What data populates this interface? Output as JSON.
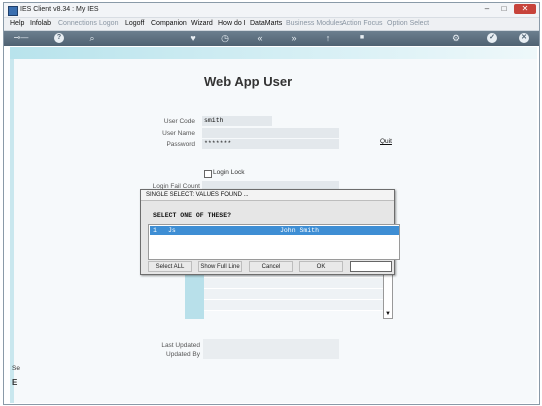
{
  "window": {
    "title": "IES Client v8.34 : My IES"
  },
  "menu": [
    {
      "label": "Help",
      "enabled": true
    },
    {
      "label": "Infolab",
      "enabled": true
    },
    {
      "label": "Connections",
      "enabled": false
    },
    {
      "label": "Logon",
      "enabled": false
    },
    {
      "label": "Logoff",
      "enabled": true
    },
    {
      "label": "Companion",
      "enabled": true
    },
    {
      "label": "Wizard",
      "enabled": true
    },
    {
      "label": "How do I",
      "enabled": true
    },
    {
      "label": "DataMarts",
      "enabled": true
    },
    {
      "label": "Business Modules",
      "enabled": false
    },
    {
      "label": "Action Focus",
      "enabled": false
    },
    {
      "label": "Option Select",
      "enabled": false
    }
  ],
  "toolbar_icons": [
    "key-icon",
    "help-icon",
    "search-icon",
    "heart-icon",
    "clock-icon",
    "rewind-icon",
    "forward-icon",
    "up-icon",
    "stop-icon",
    "gear-icon",
    "check-icon",
    "close-icon"
  ],
  "page": {
    "title": "Web App User",
    "user_code_label": "User Code",
    "user_code_value": "smith",
    "user_name_label": "User Name",
    "user_name_value": "",
    "password_label": "Password",
    "password_value": "*******",
    "quit_label": "Quit",
    "login_lock_label": "Login Lock",
    "login_fail_label": "Login Fail Count",
    "last_updated_label": "Last Updated",
    "updated_by_label": "Updated By",
    "left_cut_1": "Se",
    "left_cut_2": "E"
  },
  "dialog": {
    "title": "SINGLE SELECT: VALUES FOUND ...",
    "prompt": "SELECT ONE OF THESE?",
    "rows": [
      {
        "num": "1",
        "code": "Js",
        "name": "John Smith"
      }
    ],
    "buttons": {
      "select_all": "Select ALL",
      "show_full_line": "Show Full Line",
      "cancel": "Cancel",
      "ok": "OK"
    },
    "input_value": ""
  }
}
